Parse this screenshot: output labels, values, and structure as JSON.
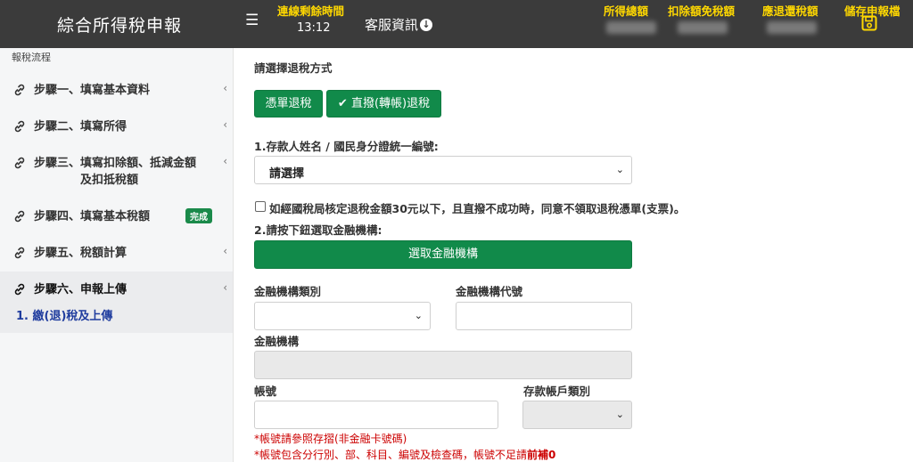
{
  "header": {
    "title": "綜合所得稅申報",
    "menu_icon": "hamburger-icon",
    "timer_label": "連線剩餘時間",
    "timer_value": "13:12",
    "service_label": "客服資訊",
    "service_icon": "chevron-circle-down-icon",
    "stats": [
      {
        "label": "所得總額"
      },
      {
        "label": "扣除額免稅額"
      },
      {
        "label": "應退還稅額"
      }
    ],
    "save_label": "儲存申報檔",
    "save_icon": "floppy-disk-icon",
    "accent_color": "#ffd800"
  },
  "sidebar": {
    "caption": "報稅流程",
    "steps": [
      {
        "label": "步驟一、填寫基本資料"
      },
      {
        "label": "步驟二、填寫所得"
      },
      {
        "label": "步驟三、填寫扣除額、抵減金額",
        "label2": "及扣抵稅額"
      },
      {
        "label": "步驟四、填寫基本稅額",
        "badge": "完成"
      },
      {
        "label": "步驟五、稅額計算"
      },
      {
        "label": "步驟六、申報上傳"
      }
    ],
    "substep": "1. 繳(退)稅及上傳"
  },
  "main": {
    "refund_heading": "請選擇退稅方式",
    "btn_check": "憑單退稅",
    "btn_transfer": "直撥(轉帳)退稅",
    "q1_label": "1.存款人姓名 / 國民身分證統一編號:",
    "q1_value": "請選擇",
    "checkbox_label": "如經國稅局核定退稅金額30元以下，且直撥不成功時，同意不領取退稅憑單(支票)。",
    "q2_label": "2.請按下鈕選取金融機構:",
    "select_bank_button": "選取金融機構",
    "bank_type_label": "金融機構類別",
    "bank_code_label": "金融機構代號",
    "bank_label": "金融機構",
    "account_label": "帳號",
    "account_type_label": "存款帳戶類別",
    "note1": "*帳號請參照存摺(非金融卡號碼)",
    "note2": "*帳號包含分行別、部、科目、編號及檢查碼，帳號不足請",
    "note2_bold": "前補0",
    "primary_color": "#118a4a"
  }
}
